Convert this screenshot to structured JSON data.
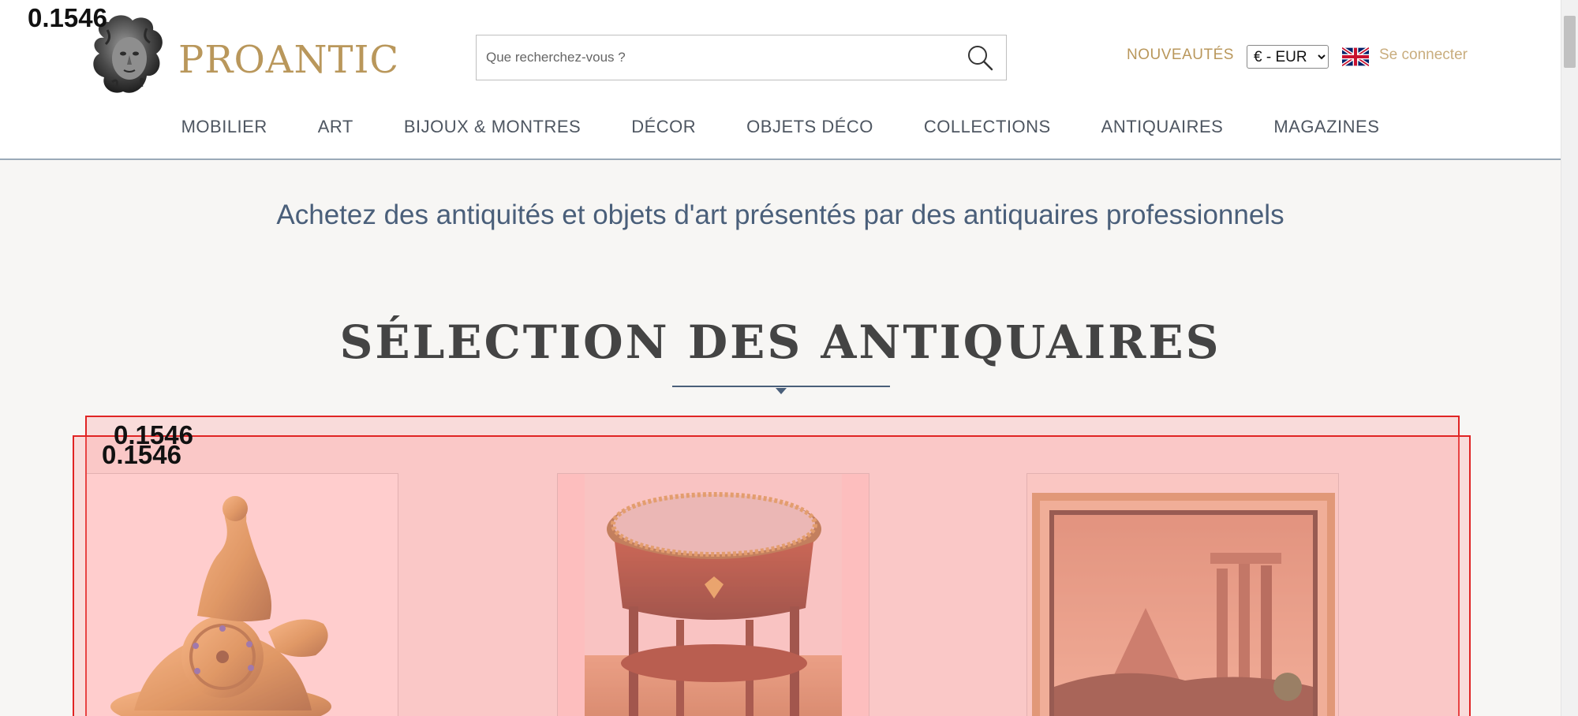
{
  "overlay": {
    "score_label": "0.1546"
  },
  "header": {
    "logo_text": "PROANTIC",
    "search_placeholder": "Que recherchez-vous ?",
    "nouveautes": "NOUVEAUTÉS",
    "currency_selected": "€ - EUR",
    "login": "Se connecter"
  },
  "nav": {
    "items": [
      "MOBILIER",
      "ART",
      "BIJOUX & MONTRES",
      "DÉCOR",
      "OBJETS DÉCO",
      "COLLECTIONS",
      "ANTIQUAIRES",
      "MAGAZINES"
    ]
  },
  "main": {
    "tagline": "Achetez des antiquités et objets d'art présentés par des antiquaires professionnels",
    "section_title": "SÉLECTION DES ANTIQUAIRES"
  },
  "colors": {
    "gold": "#b9975b",
    "slate": "#4a5f7a",
    "highlight_border": "#e02424"
  },
  "icons": [
    "medusa-head-icon",
    "search-icon",
    "uk-flag-icon",
    "chevron-down-icon"
  ]
}
